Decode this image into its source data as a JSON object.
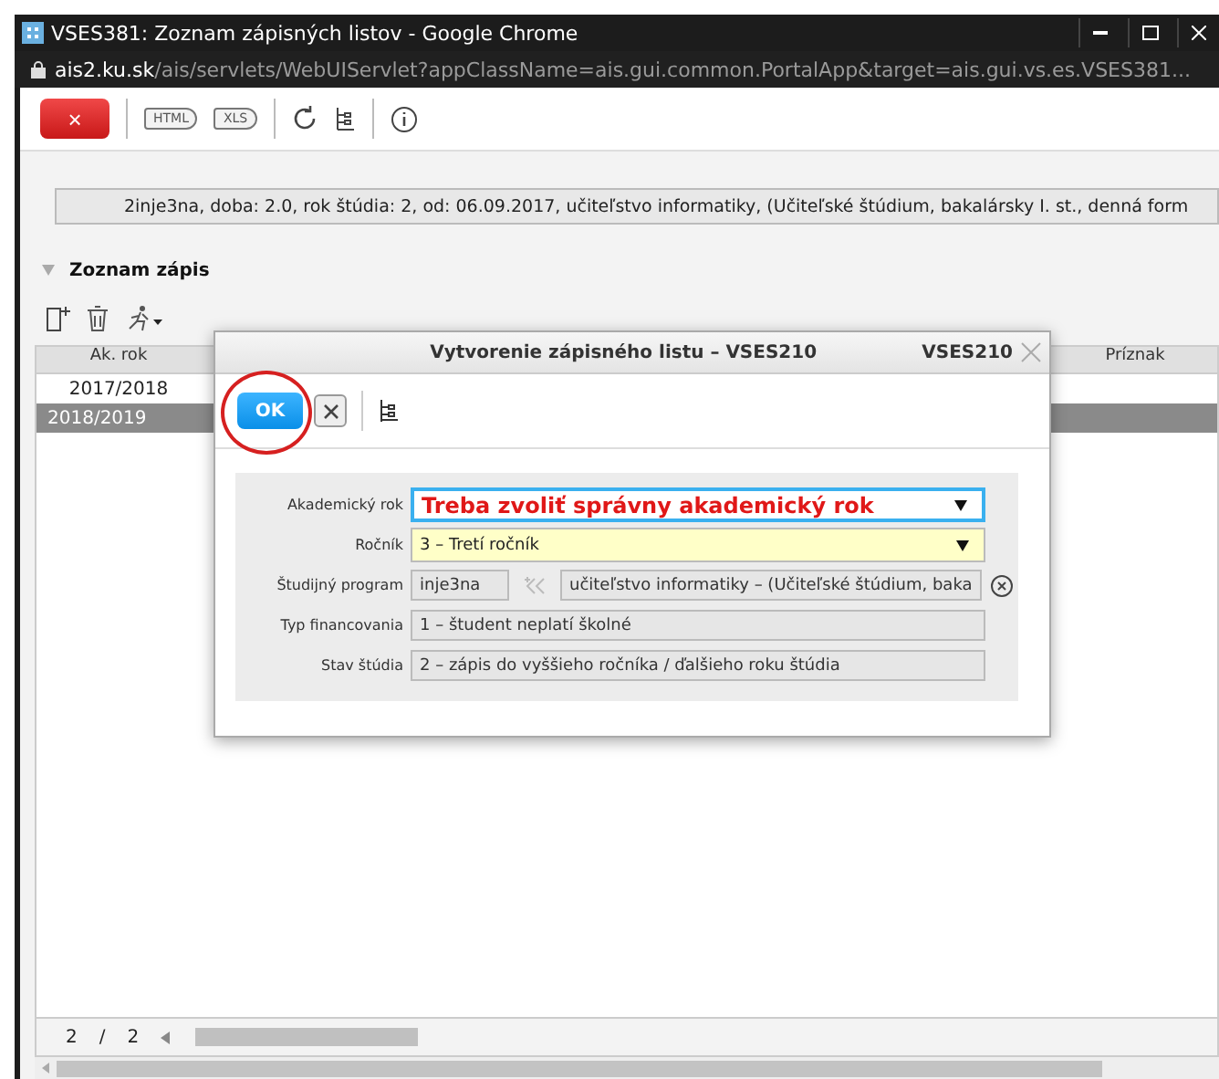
{
  "window": {
    "title": "VSES381: Zoznam zápisných listov - Google Chrome",
    "url_host": "ais2.ku.sk",
    "url_path": "/ais/servlets/WebUIServlet?appClassName=ais.gui.common.PortalApp&target=ais.gui.vs.es.VSES381..."
  },
  "toolbar": {
    "close_label": "×",
    "export_buttons": [
      "HTML",
      "XLS"
    ]
  },
  "info_bar": "2inje3na, doba: 2.0, rok štúdia: 2, od: 06.09.2017, učiteľstvo informatiky, (Učiteľské štúdium, bakalársky I. st., denná form",
  "section": {
    "title": "Zoznam zápis",
    "expanded": true
  },
  "table": {
    "columns": [
      "Ak. rok",
      "Príznak"
    ],
    "rows": [
      {
        "year": "2017/2018",
        "selected": false
      },
      {
        "year": "2018/2019",
        "selected": true
      }
    ],
    "pager": {
      "page": "2",
      "separator": "/",
      "total": "2"
    }
  },
  "dialog": {
    "title": "Vytvorenie zápisného listu – VSES210",
    "code": "VSES210",
    "ok_label": "OK",
    "ok_circled": true,
    "fields": [
      {
        "label": "Akademický rok",
        "kind": "dropdown",
        "value": "Treba zvoliť správny akademický rok",
        "focused": true,
        "warning": true,
        "required": false
      },
      {
        "label": "Ročník",
        "kind": "dropdown",
        "value": "3 – Tretí ročník",
        "focused": false,
        "warning": false,
        "required": true
      },
      {
        "label": "Študijný program",
        "kind": "program",
        "code": "inje3na",
        "value": "učiteľstvo informatiky – (Učiteľské štúdium, baka"
      },
      {
        "label": "Typ financovania",
        "kind": "readonly",
        "value": "1 – študent neplatí školné"
      },
      {
        "label": "Stav štúdia",
        "kind": "readonly",
        "value": "2 – zápis do vyššieho ročníka / ďalšieho roku štúdia"
      }
    ]
  }
}
